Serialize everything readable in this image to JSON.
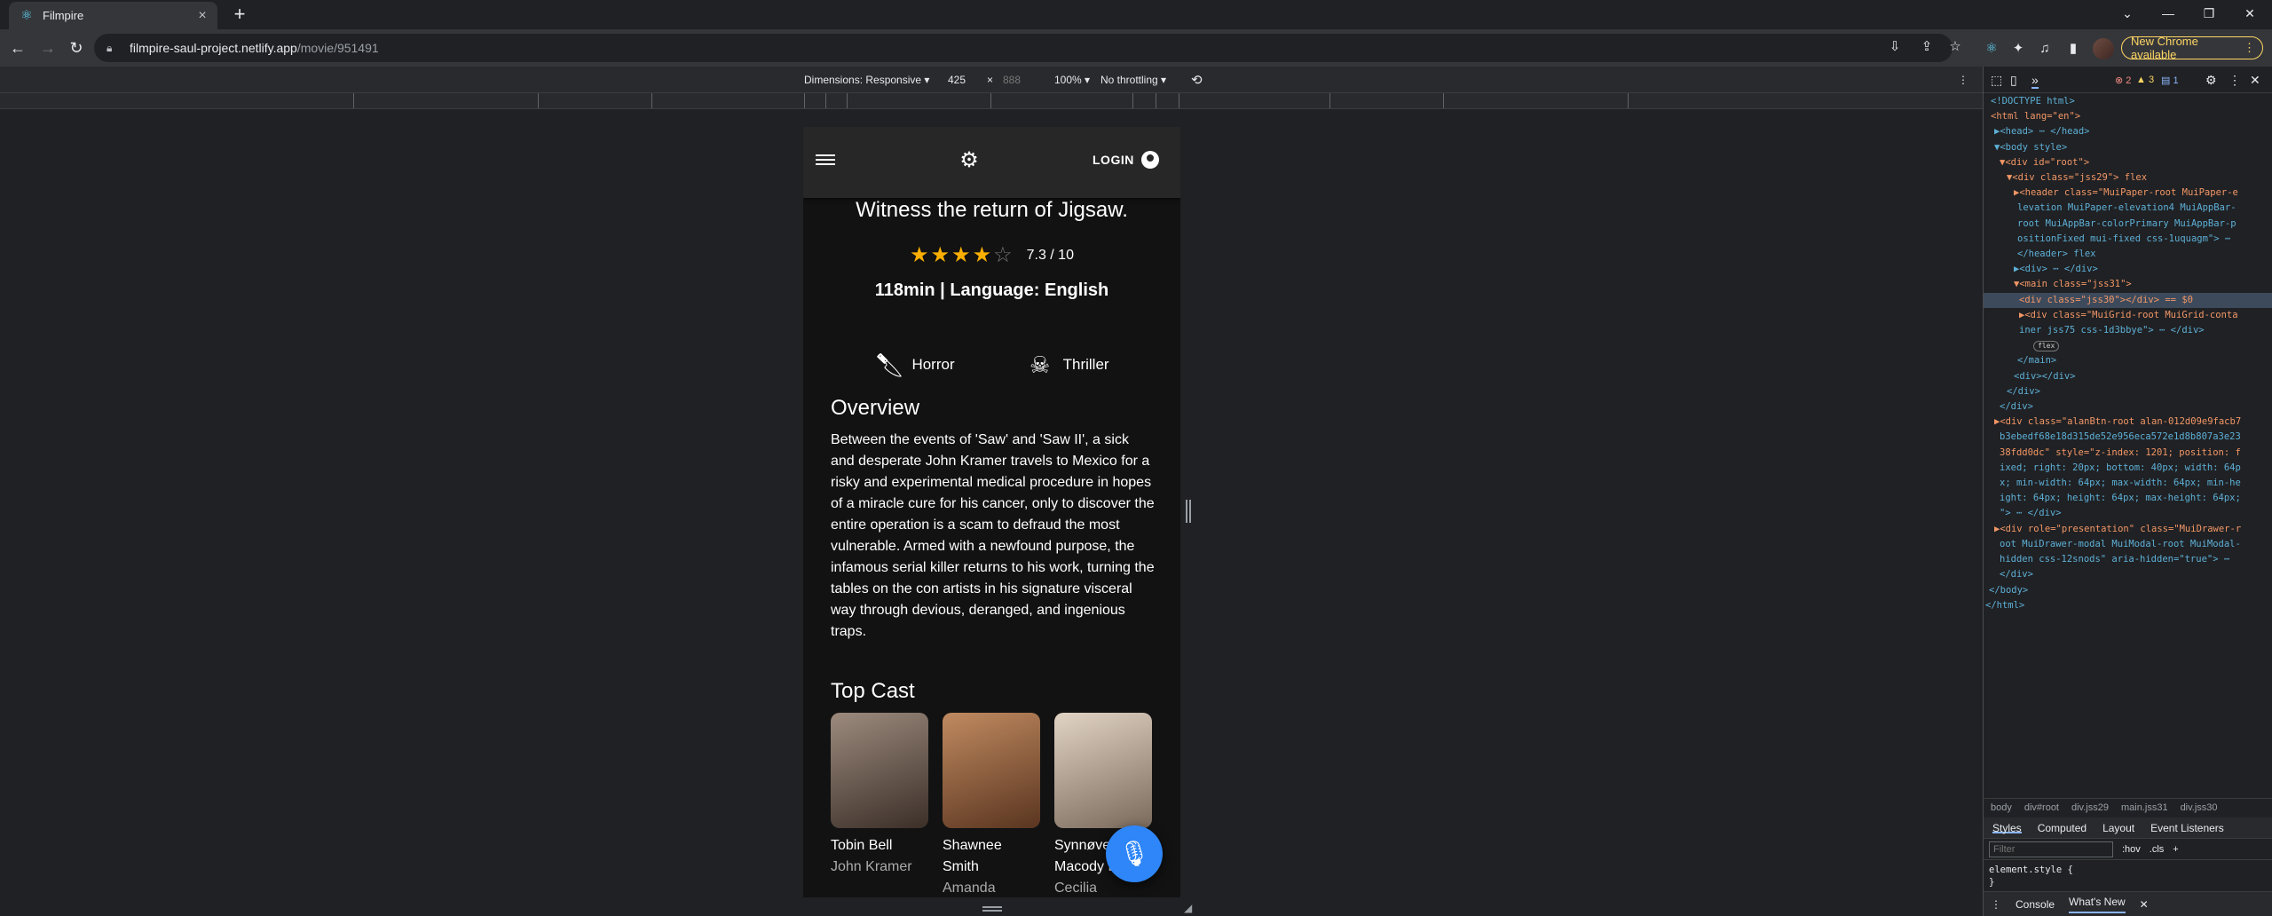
{
  "browser": {
    "tab_title": "Filmpire",
    "url_host": "filmpire-saul-project.netlify.app",
    "url_path": "/movie/951491",
    "update_label": "New Chrome available"
  },
  "device_toolbar": {
    "dimensions": "Dimensions: Responsive",
    "width": "425",
    "times": "×",
    "height": "888",
    "zoom": "100%",
    "throttle": "No throttling"
  },
  "app": {
    "login_label": "LOGIN",
    "tagline": "Witness the return of Jigsaw.",
    "rating": {
      "stars_filled": 4,
      "stars_total": 5,
      "label": "7.3 / 10"
    },
    "runtime": "118min | Language: English",
    "genres": [
      {
        "label": "Horror",
        "icon": "knife-icon"
      },
      {
        "label": "Thriller",
        "icon": "skull-icon"
      }
    ],
    "overview_heading": "Overview",
    "overview_text": "Between the events of 'Saw' and 'Saw II', a sick and desperate John Kramer travels to Mexico for a risky and experimental medical procedure in hopes of a miracle cure for his cancer, only to discover the entire operation is a scam to defraud the most vulnerable. Armed with a newfound purpose, the infamous serial killer returns to his work, turning the tables on the con artists in his signature visceral way through devious, deranged, and ingenious traps.",
    "cast_heading": "Top Cast",
    "cast": [
      {
        "name": "Tobin Bell",
        "character": "John Kramer",
        "photo_color": "#6b5a4e"
      },
      {
        "name": "Shawnee Smith",
        "character": "Amanda",
        "photo_color": "#8a5a3c"
      },
      {
        "name": "Synnøve Macody Lund",
        "character": "Cecilia",
        "photo_color": "#c9b7a3"
      }
    ]
  },
  "devtools": {
    "errors": "2",
    "warnings": "3",
    "info": "1",
    "breadcrumbs": [
      "body",
      "div#root",
      "div.jss29",
      "main.jss31",
      "div.jss30"
    ],
    "style_tabs": [
      "Styles",
      "Computed",
      "Layout",
      "Event Listeners"
    ],
    "filter_placeholder": "Filter",
    "hov": ":hov",
    "cls": ".cls",
    "element_style": "element.style {",
    "element_style_close": "}",
    "drawer_tabs": [
      "Console",
      "What's New"
    ],
    "dom_lines": [
      "<!DOCTYPE html>",
      "<html lang=\"en\">",
      "▶<head> ⋯ </head>",
      "▼<body style>",
      "▼<div id=\"root\">",
      "▼<div class=\"jss29\"> flex",
      "▶<header class=\"MuiPaper-root MuiPaper-e",
      "levation MuiPaper-elevation4 MuiAppBar-",
      "root MuiAppBar-colorPrimary MuiAppBar-p",
      "ositionFixed mui-fixed css-1uquagm\"> ⋯",
      "</header> flex",
      "▶<div> ⋯ </div>",
      "▼<main class=\"jss31\">",
      "<div class=\"jss30\"></div> == $0",
      "▶<div class=\"MuiGrid-root MuiGrid-conta",
      "iner jss75 css-1d3bbye\"> ⋯ </div>",
      "flex",
      "</main>",
      "<div></div>",
      "</div>",
      "</div>",
      "▶<div class=\"alanBtn-root alan-012d09e9facb7",
      "b3ebedf68e18d315de52e956eca572e1d8b807a3e23",
      "38fdd0dc\" style=\"z-index: 1201; position: f",
      "ixed; right: 20px; bottom: 40px; width: 64p",
      "x; min-width: 64px; max-width: 64px; min-he",
      "ight: 64px; height: 64px; max-height: 64px;",
      "\"> ⋯ </div>",
      "▶<div role=\"presentation\" class=\"MuiDrawer-r",
      "oot MuiDrawer-modal MuiModal-root MuiModal-",
      "hidden css-12snods\" aria-hidden=\"true\"> ⋯",
      "</div>",
      "</body>",
      "</html>"
    ]
  }
}
